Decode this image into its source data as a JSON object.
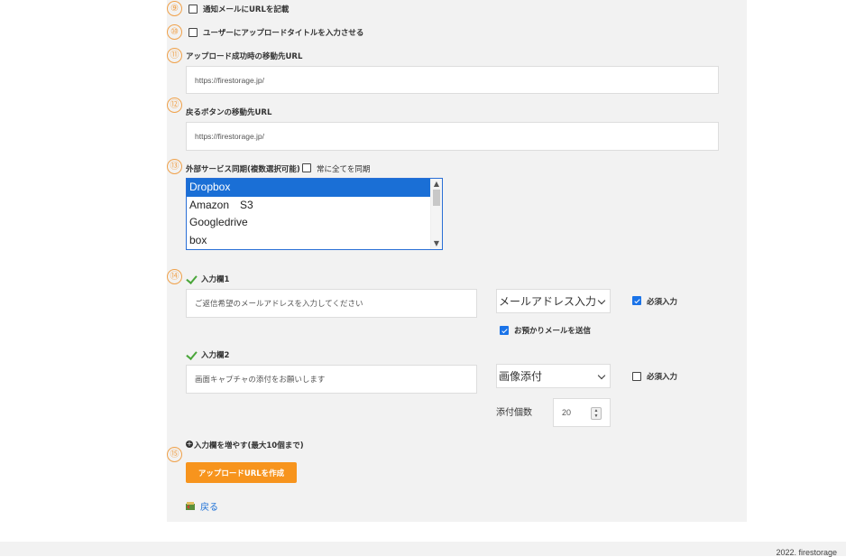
{
  "items": {
    "n9": {
      "num": "⑨",
      "label": "通知メールにURLを記載"
    },
    "n10": {
      "num": "⑩",
      "label": "ユーザーにアップロードタイトルを入力させる"
    },
    "n11": {
      "num": "⑪",
      "label": "アップロード成功時の移動先URL",
      "value": "https://firestorage.jp/"
    },
    "n12": {
      "num": "⑫",
      "label": "戻るボタンの移動先URL",
      "value": "https://firestorage.jp/"
    },
    "n13": {
      "num": "⑬",
      "label": "外部サービス同期(複数選択可能)",
      "sync_all_label": "常に全てを同期",
      "options": [
        "Dropbox",
        "Amazon　S3",
        "Googledrive",
        "box"
      ],
      "selected": "Dropbox"
    },
    "n14": {
      "num": "⑭",
      "field1": {
        "title": "入力欄1",
        "placeholder": "ご返信希望のメールアドレスを入力してください",
        "type": "メールアドレス入力",
        "required_label": "必須入力",
        "required": true,
        "send_mail_label": "お預かりメールを送信",
        "send_mail": true
      },
      "field2": {
        "title": "入力欄2",
        "placeholder": "画面キャプチャの添付をお願いします",
        "type": "画像添付",
        "required_label": "必須入力",
        "required": false,
        "attach_count_label": "添付個数",
        "attach_count": "20"
      },
      "add_label": "入力欄を増やす(最大10個まで)"
    },
    "n15": {
      "num": "⑮",
      "create_button": "アップロードURLを作成"
    }
  },
  "back_link": "戻る",
  "footer": {
    "copyright": "2022. firestorage"
  },
  "colors": {
    "accent_orange": "#f7941d",
    "number_circle": "#f0a14a",
    "link_blue": "#1a6fd6",
    "check_green": "#4aa63a",
    "select_blue": "#1a73e8"
  }
}
